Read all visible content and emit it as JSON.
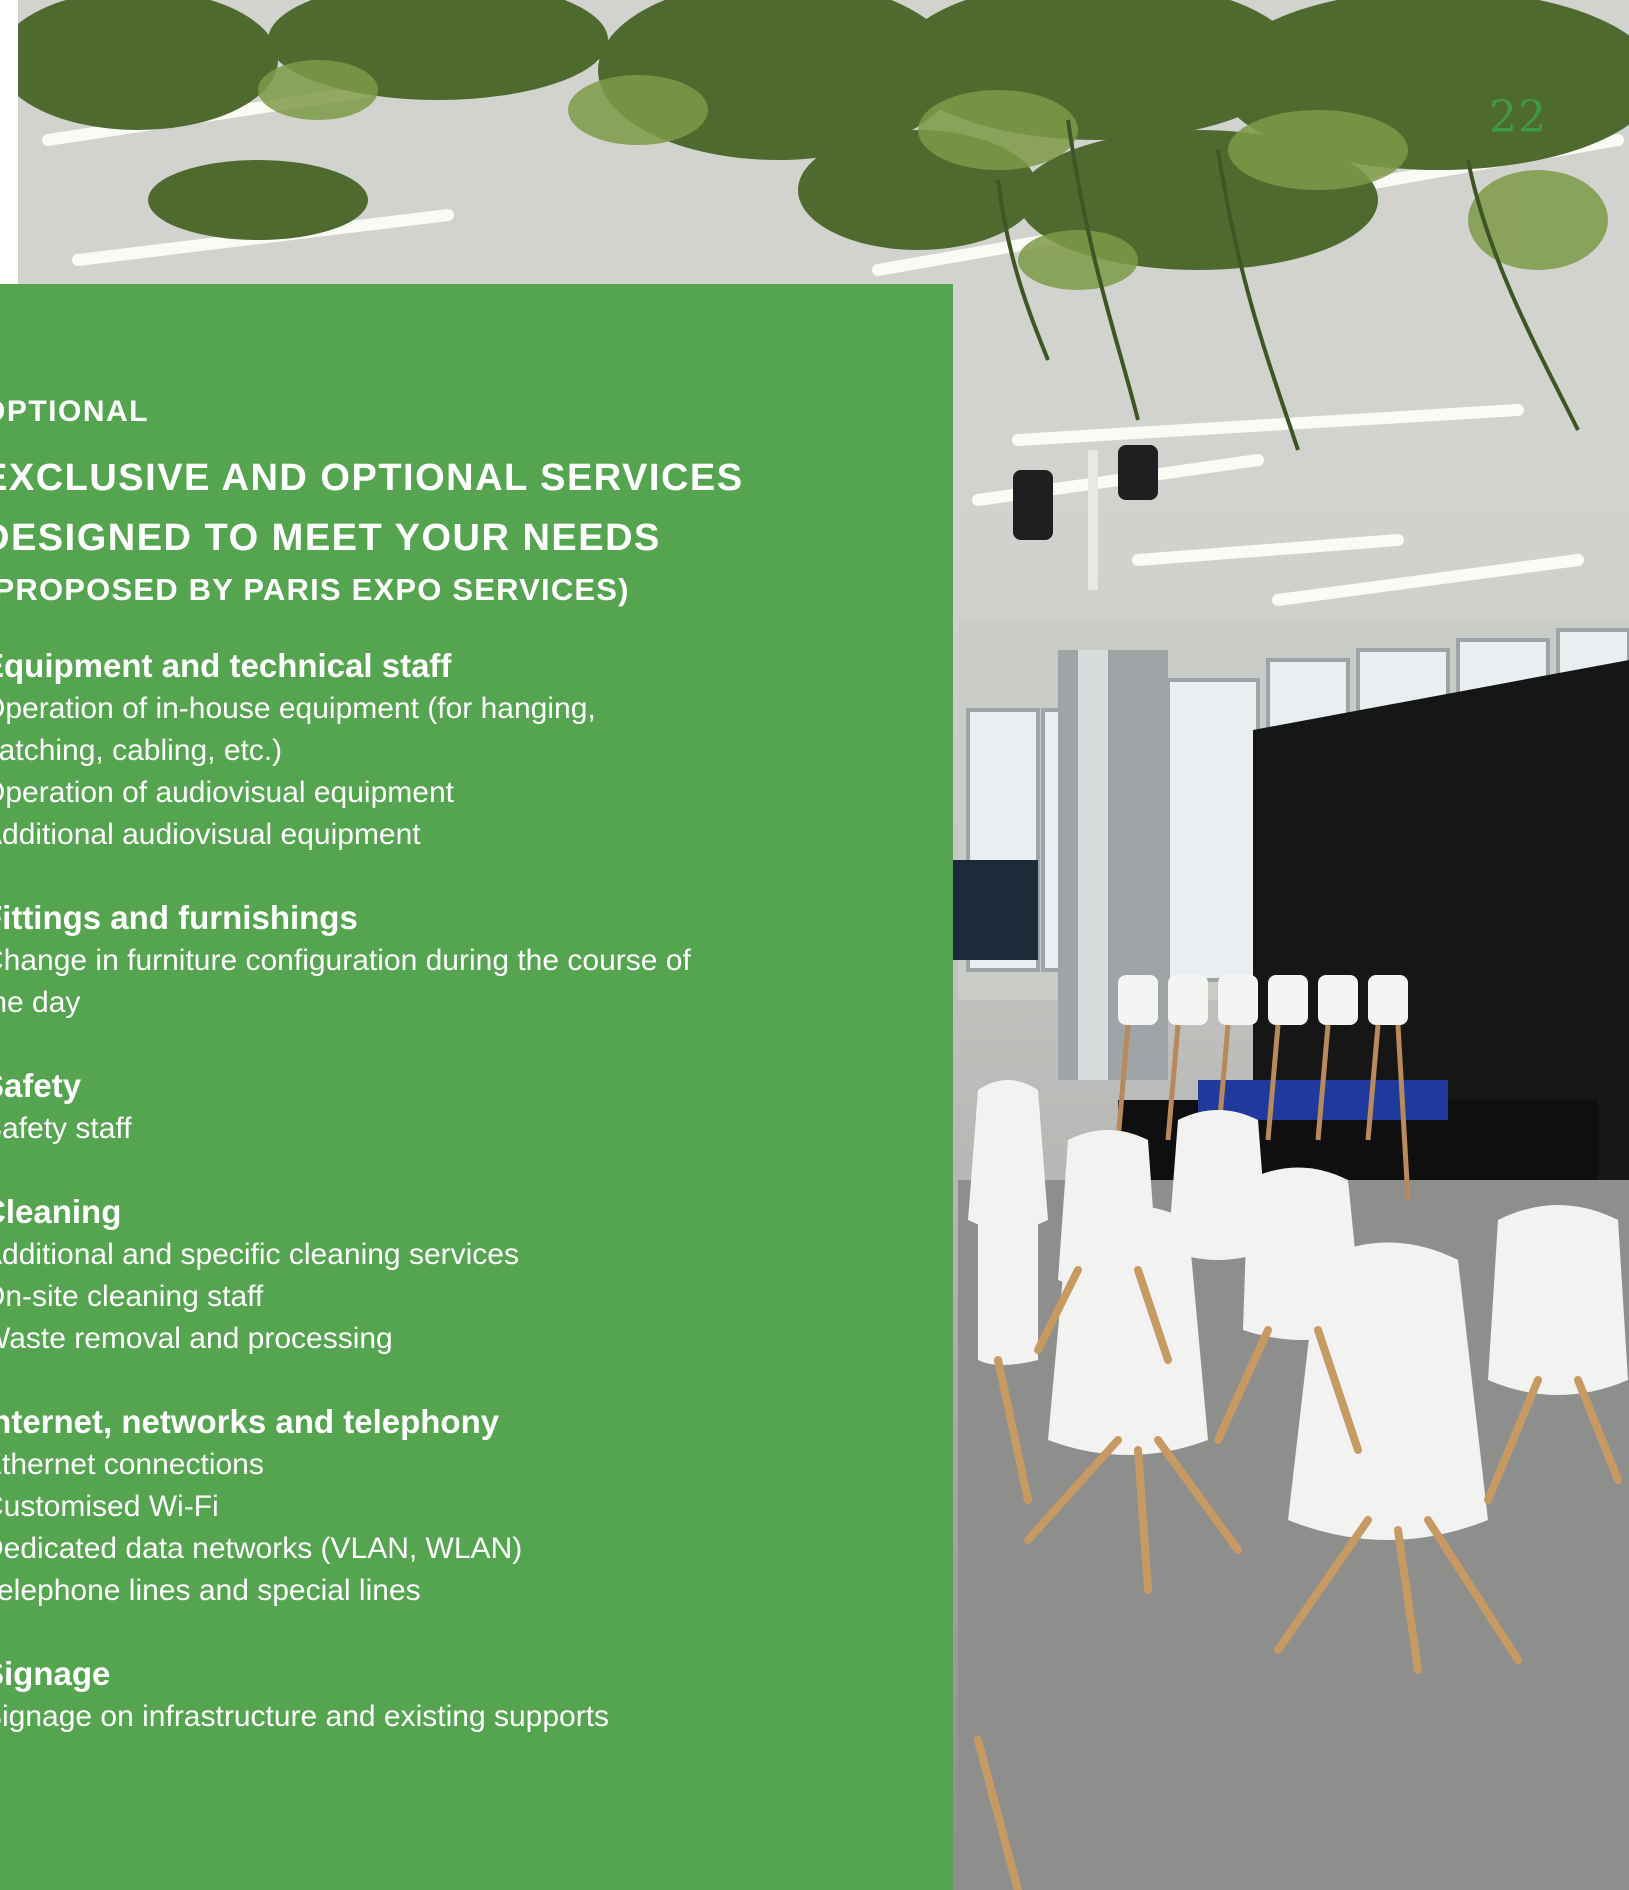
{
  "page_number": "22",
  "panel": {
    "kicker": "OPTIONAL",
    "title_line1": "EXCLUSIVE AND OPTIONAL SERVICES",
    "title_line2": "DESIGNED TO MEET YOUR NEEDS",
    "subtitle": "(PROPOSED BY PARIS EXPO SERVICES)"
  },
  "sections": [
    {
      "heading": "Equipment and technical staff",
      "items": [
        "Operation of in-house equipment (for hanging,",
        "patching, cabling, etc.)",
        "Operation of audiovisual equipment",
        "Additional audiovisual equipment"
      ]
    },
    {
      "heading": "Fittings and furnishings",
      "items": [
        "Change in furniture configuration during the course of",
        "the day"
      ]
    },
    {
      "heading": "Safety",
      "items": [
        "Safety staff"
      ]
    },
    {
      "heading": "Cleaning",
      "items": [
        "Additional and specific cleaning services",
        "On-site cleaning staff",
        "Waste removal and processing"
      ]
    },
    {
      "heading": "Internet, networks and telephony",
      "items": [
        "Ethernet connections",
        "Customised Wi-Fi",
        "Dedicated data networks (VLAN, WLAN)",
        "Telephone lines and special lines"
      ]
    },
    {
      "heading": "Signage",
      "items": [
        "Signage on infrastructure and existing supports"
      ]
    }
  ],
  "colors": {
    "panel_green": "#55a550",
    "page_number_green": "#3f9a43"
  }
}
